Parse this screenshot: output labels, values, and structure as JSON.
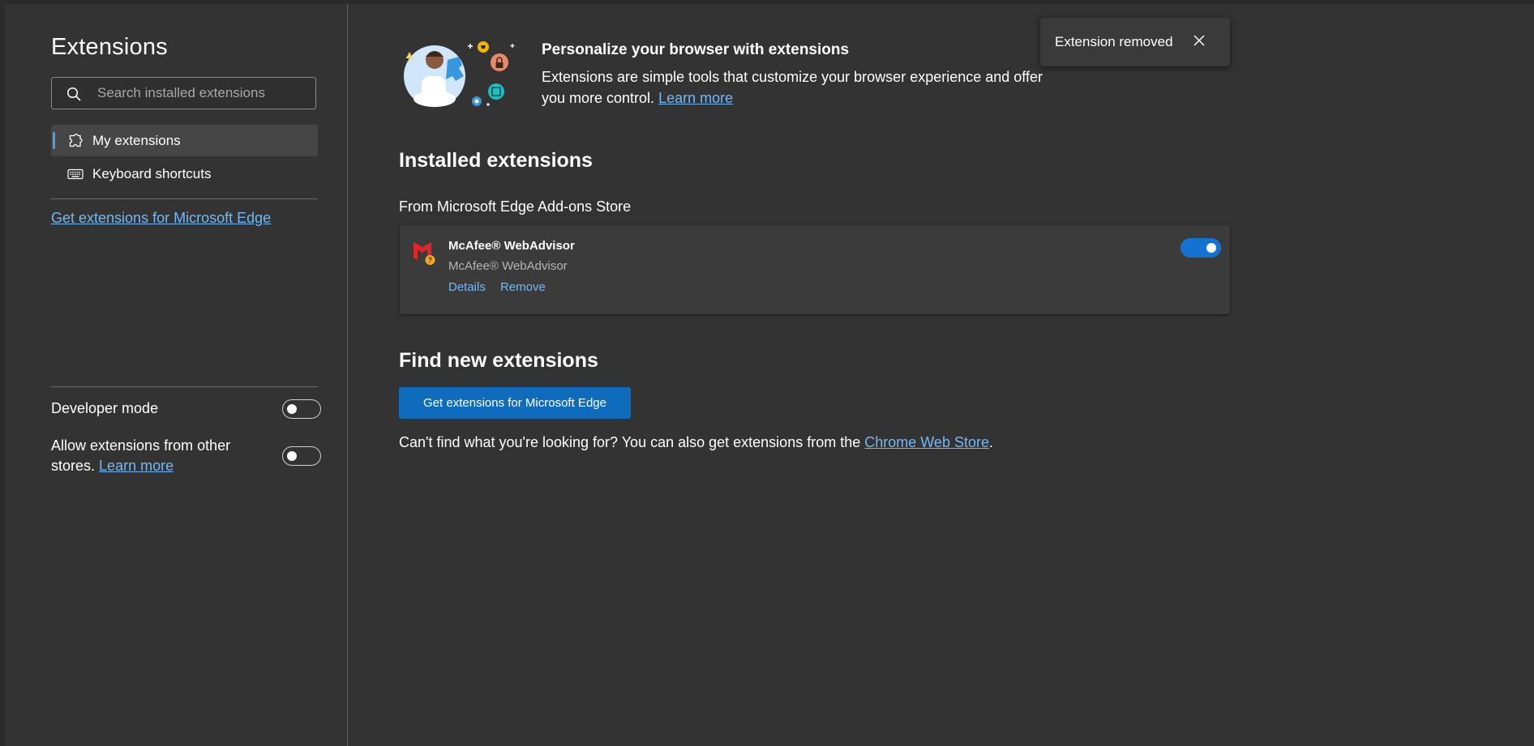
{
  "sidebar": {
    "title": "Extensions",
    "search_placeholder": "Search installed extensions",
    "nav_items": [
      {
        "label": "My extensions",
        "icon": "puzzle-icon",
        "active": true
      },
      {
        "label": "Keyboard shortcuts",
        "icon": "keyboard-icon",
        "active": false
      }
    ],
    "store_link": "Get extensions for Microsoft Edge",
    "developer_mode": {
      "label": "Developer mode",
      "enabled": false
    },
    "allow_other_stores": {
      "label": "Allow extensions from other stores.",
      "link": "Learn more",
      "enabled": false
    }
  },
  "hero": {
    "title": "Personalize your browser with extensions",
    "description": "Extensions are simple tools that customize your browser experience and offer you more control.",
    "link": "Learn more"
  },
  "installed": {
    "heading": "Installed extensions",
    "source": "From Microsoft Edge Add-ons Store",
    "extensions": [
      {
        "name": "McAfee® WebAdvisor",
        "subtitle": "McAfee® WebAdvisor",
        "icon": "mcafee-logo-icon",
        "enabled": true,
        "actions": [
          "Details",
          "Remove"
        ]
      }
    ]
  },
  "find": {
    "heading": "Find new extensions",
    "button_label": "Get extensions for Microsoft Edge",
    "text_before": "Can't find what you're looking for? You can also get extensions from the",
    "link": "Chrome Web Store",
    "text_after": "."
  },
  "toast": {
    "message": "Extension removed",
    "close_icon": "close-icon"
  },
  "colors": {
    "background": "#333333",
    "accent": "#0f6cbd",
    "link": "#72b8f7",
    "toggle_on": "#1473d1"
  }
}
